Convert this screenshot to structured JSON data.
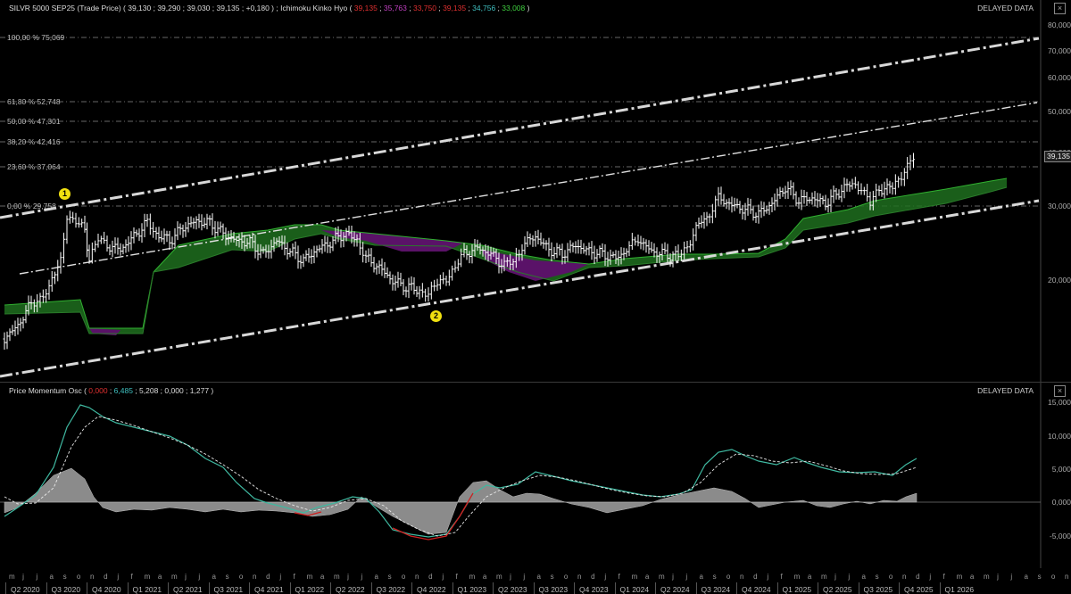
{
  "price_header": {
    "instrument": "SILVR 5000 SEP25 (Trade Price)",
    "ohlc": "( 39,130 ; 39,290 ; 39,030 ; 39,135 ; +0,180 )",
    "indicator": "; Ichimoku Kinko Hyo",
    "ichimoku_values": [
      {
        "text": "39,135",
        "color": "#e03030"
      },
      {
        "text": "35,763",
        "color": "#c040c0"
      },
      {
        "text": "33,750",
        "color": "#e03030"
      },
      {
        "text": "39,135",
        "color": "#e03030"
      },
      {
        "text": "34,756",
        "color": "#40c0c0"
      },
      {
        "text": "33,008",
        "color": "#40d040"
      }
    ]
  },
  "delayed_label": "DELAYED DATA",
  "close_symbol": "×",
  "fib_levels": [
    {
      "label": "100,00 % 75,069"
    },
    {
      "label": "61,80 % 52,748"
    },
    {
      "label": "50,00 % 47,301"
    },
    {
      "label": "38,20 % 42,416"
    },
    {
      "label": "23,60 % 37,064"
    },
    {
      "label": "0,00 % 29,758"
    }
  ],
  "price_axis_ticks": [
    "80,000",
    "70,000",
    "60,000",
    "50,000",
    "40,000",
    "30,000",
    "20,000"
  ],
  "last_price_tag": "39,135",
  "markers": [
    {
      "label": "1"
    },
    {
      "label": "2"
    }
  ],
  "osc_header": {
    "title": "Price Momentum Osc",
    "values": [
      {
        "text": "0,000",
        "color": "#e03030"
      },
      {
        "text": "6,485",
        "color": "#40c0c0"
      },
      {
        "text": "5,208",
        "color": "#dddddd"
      },
      {
        "text": "0,000",
        "color": "#dddddd"
      },
      {
        "text": "1,277",
        "color": "#dddddd"
      }
    ]
  },
  "osc_axis_ticks": [
    "15,000",
    "10,000",
    "5,000",
    "0,000",
    "-5,000"
  ],
  "quarters": [
    "Q2 2020",
    "Q3 2020",
    "Q4 2020",
    "Q1 2021",
    "Q2 2021",
    "Q3 2021",
    "Q4 2021",
    "Q1 2022",
    "Q2 2022",
    "Q3 2022",
    "Q4 2022",
    "Q1 2023",
    "Q2 2023",
    "Q3 2023",
    "Q4 2023",
    "Q1 2024",
    "Q2 2024",
    "Q3 2024",
    "Q4 2024",
    "Q1 2025",
    "Q2 2025",
    "Q3 2025",
    "Q4 2025",
    "Q1 2026"
  ],
  "months": [
    "m",
    "j",
    "j",
    "a",
    "s",
    "o",
    "n",
    "d",
    "j",
    "f",
    "m",
    "a",
    "m",
    "j",
    "j",
    "a",
    "s",
    "o",
    "n",
    "d",
    "j",
    "f",
    "m",
    "a",
    "m",
    "j",
    "j",
    "a",
    "s",
    "o",
    "n",
    "d",
    "j",
    "f",
    "m",
    "a",
    "m",
    "j",
    "j",
    "a",
    "s",
    "o",
    "n",
    "d",
    "j",
    "f",
    "m",
    "a",
    "m",
    "j",
    "j",
    "a",
    "s",
    "o",
    "n",
    "d",
    "j",
    "f",
    "m",
    "a",
    "m",
    "j",
    "j",
    "a",
    "s",
    "o",
    "n",
    "d",
    "j",
    "f",
    "m",
    "a",
    "m",
    "j",
    "j",
    "a",
    "s",
    "o",
    "n",
    "d",
    "j",
    "f",
    "m"
  ],
  "colors": {
    "background": "#000000",
    "candle": "#ffffff",
    "cloud_bull": "#1f6e1f",
    "cloud_bear": "#5a1268",
    "momentum": "#3fb8a0",
    "signal": "#e8e8e8",
    "histogram": "#9a9a9a",
    "marker": "#f0e010"
  }
}
